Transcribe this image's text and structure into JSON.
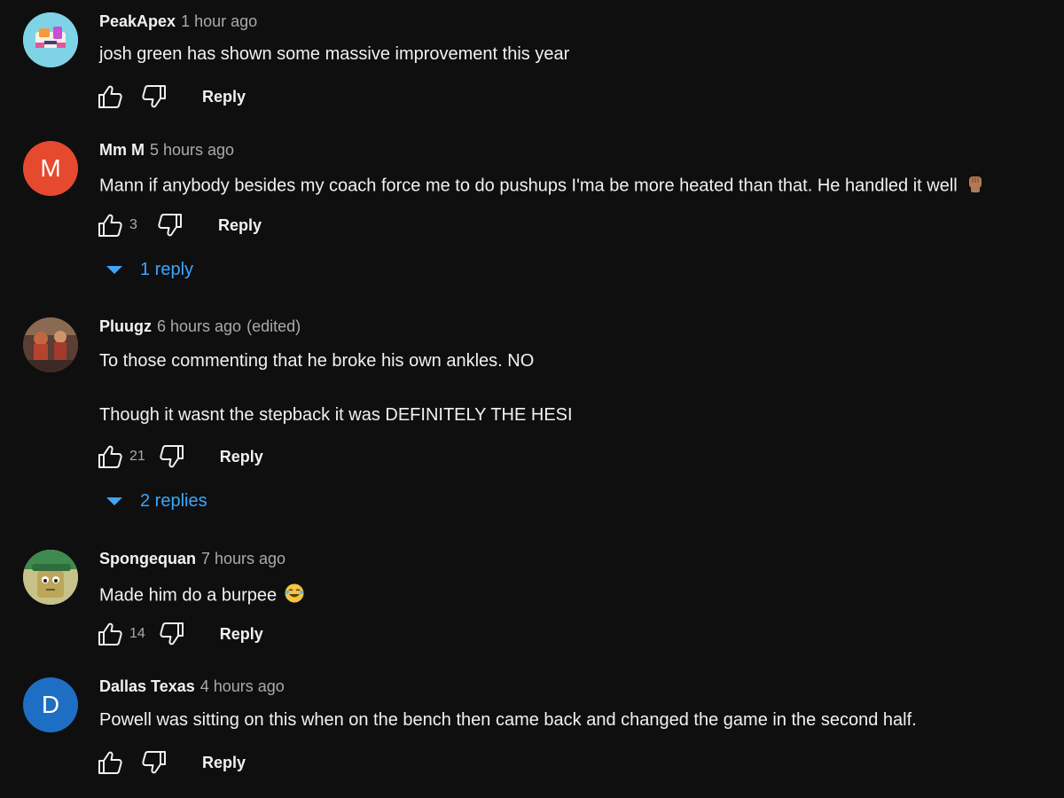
{
  "colors": {
    "background": "#0f0f0f",
    "text_primary": "#f1f1f1",
    "text_secondary": "#aaaaaa",
    "link_blue": "#3ea6ff",
    "avatar_mm": "#e64a2e",
    "avatar_d": "#1e6fc4"
  },
  "comments": [
    {
      "author": "PeakApex",
      "time": "1 hour ago",
      "text": "josh green has shown some massive improvement this year",
      "likes": "",
      "reply_label": "Reply",
      "avatar_icon": "cartoon-avatar-icon"
    },
    {
      "author": "Mm M",
      "time": "5 hours ago",
      "avatar_letter": "M",
      "text": "Mann if anybody besides my coach force me to do pushups I'ma be more heated than that. He handled it well",
      "emoji": "raised-fist-emoji",
      "likes": "3",
      "reply_label": "Reply",
      "replies_label": "1 reply"
    },
    {
      "author": "Pluugz",
      "time": "6 hours ago",
      "edited": "(edited)",
      "text_line1": "To those commenting that he broke his own ankles. NO",
      "text_line2": "Though it wasnt the stepback it was DEFINITELY THE HESI",
      "likes": "21",
      "reply_label": "Reply",
      "replies_label": "2 replies",
      "avatar_icon": "photo-avatar-icon"
    },
    {
      "author": "Spongequan",
      "time": "7 hours ago",
      "text": "Made him do a burpee",
      "emoji": "laughing-emoji",
      "likes": "14",
      "reply_label": "Reply",
      "avatar_icon": "cartoon-cap-avatar-icon"
    },
    {
      "author": "Dallas Texas",
      "time": "4 hours ago",
      "avatar_letter": "D",
      "text": "Powell was sitting on this when on the bench then came back and changed the game in the second half.",
      "likes": "",
      "reply_label": "Reply"
    }
  ]
}
